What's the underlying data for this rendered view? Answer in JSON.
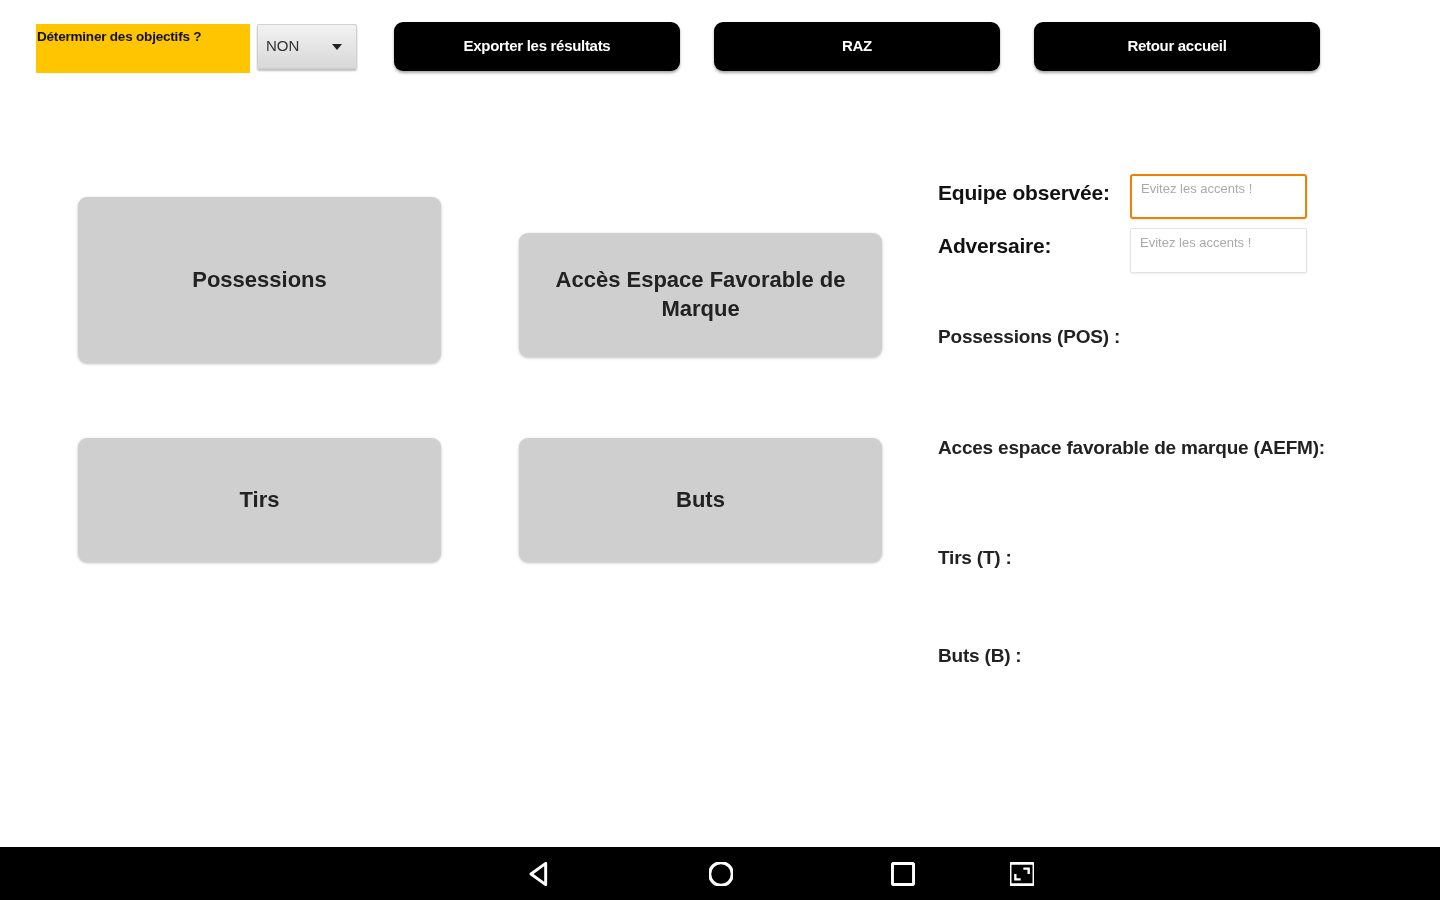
{
  "top_bar": {
    "objectives_label": "Déterminer des objectifs ?",
    "objectives_dropdown": {
      "value": "NON"
    },
    "buttons": [
      "Exporter les résultats",
      "RAZ",
      "Retour accueil"
    ]
  },
  "counter_buttons": [
    "Possessions",
    "Accès Espace Favorable de Marque",
    "Tirs",
    "Buts"
  ],
  "team_fields": [
    {
      "label": "Equipe observée:",
      "placeholder": "Evitez les accents !",
      "focused": true
    },
    {
      "label": "Adversaire:",
      "placeholder": "Evitez les accents !",
      "focused": false
    }
  ],
  "stats": [
    "Possessions (POS) :",
    "Acces espace favorable de marque (AEFM):",
    "Tirs (T) :",
    "Buts (B) :"
  ]
}
